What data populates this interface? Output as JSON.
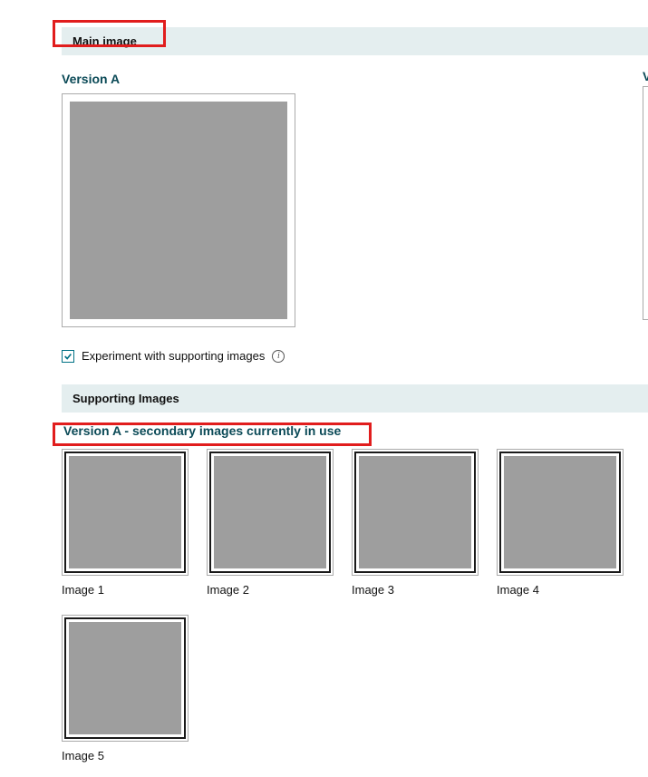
{
  "sections": {
    "main_image": {
      "header": "Main image",
      "version_a_label": "Version A",
      "version_b_label_clip": "V"
    },
    "supporting": {
      "header": "Supporting Images",
      "subtitle": "Version A - secondary images currently in use"
    }
  },
  "checkbox": {
    "label": "Experiment with supporting images",
    "checked": true
  },
  "thumbnails": [
    {
      "label": "Image 1"
    },
    {
      "label": "Image 2"
    },
    {
      "label": "Image 3"
    },
    {
      "label": "Image 4"
    },
    {
      "label": "Image 5"
    }
  ]
}
